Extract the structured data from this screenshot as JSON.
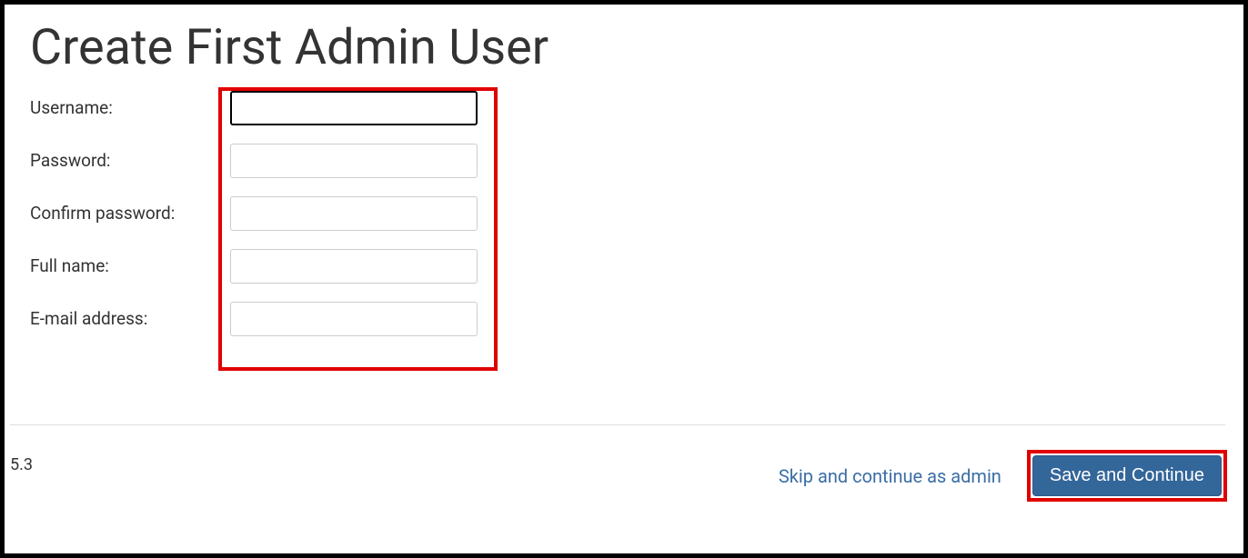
{
  "page": {
    "title": "Create First Admin User"
  },
  "form": {
    "username": {
      "label": "Username:",
      "value": ""
    },
    "password": {
      "label": "Password:",
      "value": ""
    },
    "confirm_password": {
      "label": "Confirm password:",
      "value": ""
    },
    "full_name": {
      "label": "Full name:",
      "value": ""
    },
    "email": {
      "label": "E-mail address:",
      "value": ""
    }
  },
  "footer": {
    "version": "5.3",
    "skip_link": "Skip and continue as admin",
    "primary_button": "Save and Continue"
  }
}
